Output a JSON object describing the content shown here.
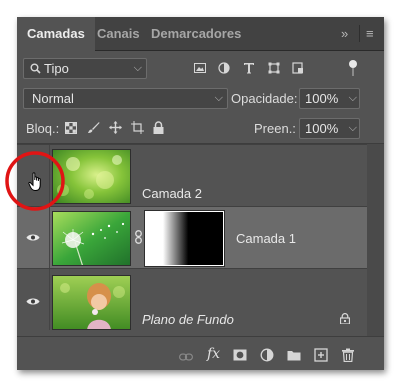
{
  "tabs": [
    {
      "label": "Camadas",
      "active": true
    },
    {
      "label": "Canais",
      "active": false
    },
    {
      "label": "Demarcadores",
      "active": false
    }
  ],
  "tab_menu": {
    "collapse": "»",
    "menu": "≡"
  },
  "filter": {
    "label": "Tipo",
    "search_icon": "search-icon",
    "chevron": "⌵"
  },
  "filter_icons": [
    "image-filter-icon",
    "adjustment-filter-icon",
    "type-filter-icon",
    "shape-filter-icon",
    "smart-object-filter-icon",
    "filter-toggle"
  ],
  "blend": {
    "mode": "Normal",
    "chevron": "⌵",
    "opacity_label": "Opacidade:",
    "opacity_value": "100%"
  },
  "lock": {
    "label": "Bloq.:",
    "fill_label": "Preen.:",
    "fill_value": "100%"
  },
  "layers": [
    {
      "name": "Camada 2",
      "visible": false,
      "selected": false,
      "italic": false
    },
    {
      "name": "Camada 1",
      "visible": true,
      "selected": true,
      "italic": false,
      "has_mask": true
    },
    {
      "name": "Plano de Fundo",
      "visible": true,
      "selected": false,
      "italic": true,
      "locked": true
    }
  ],
  "highlight_color": "#e01414",
  "bottom_icons": [
    "link-layers-icon",
    "fx-icon",
    "add-mask-icon",
    "adjustment-layer-icon",
    "new-group-icon",
    "new-layer-icon",
    "delete-icon"
  ],
  "fx_label": "fx"
}
